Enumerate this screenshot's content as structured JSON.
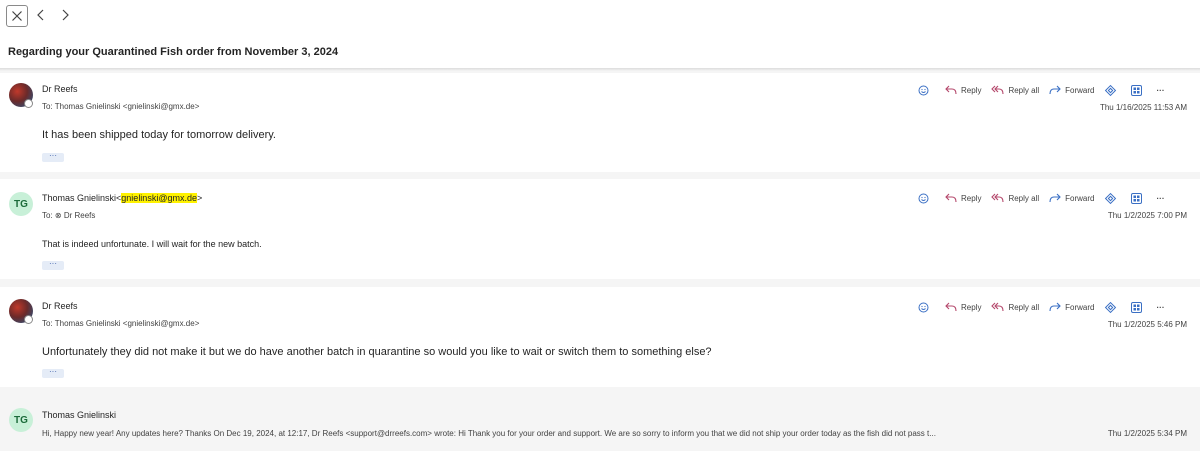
{
  "subject": "Regarding your Quarantined Fish order from November 3, 2024",
  "actions": {
    "reply": "Reply",
    "reply_all": "Reply all",
    "forward": "Forward",
    "more": "···"
  },
  "messages": [
    {
      "sender": "Dr Reefs",
      "to": "To:  Thomas Gnielinski <gnielinski@gmx.de>",
      "date": "Thu 1/16/2025 11:53 AM",
      "body": "It has been shipped today for tomorrow delivery.",
      "expand": "···"
    },
    {
      "initials": "TG",
      "sender_name": "Thomas Gnielinski<",
      "sender_email": "gnielinski@gmx.de",
      "sender_close": ">",
      "to": "To:  ⊗ Dr Reefs",
      "date": "Thu 1/2/2025 7:00 PM",
      "body": "That is indeed unfortunate. I will wait for the new batch.",
      "expand": "···"
    },
    {
      "sender": "Dr Reefs",
      "to": "To:  Thomas Gnielinski <gnielinski@gmx.de>",
      "date": "Thu 1/2/2025 5:46 PM",
      "body": "Unfortunately they did not make it but we do have another batch in quarantine so would you like to wait or switch them to something else?",
      "expand": "···"
    },
    {
      "initials": "TG",
      "sender": "Thomas Gnielinski",
      "preview": "Hi, Happy new year! Any updates here? Thanks On Dec 19, 2024, at 12:17, Dr Reefs <support@drreefs.com> wrote:  Hi Thank you for your order and support. We are so sorry to inform you that we did not ship your order today as the fish did not pass t...",
      "date": "Thu 1/2/2025 5:34 PM"
    }
  ]
}
